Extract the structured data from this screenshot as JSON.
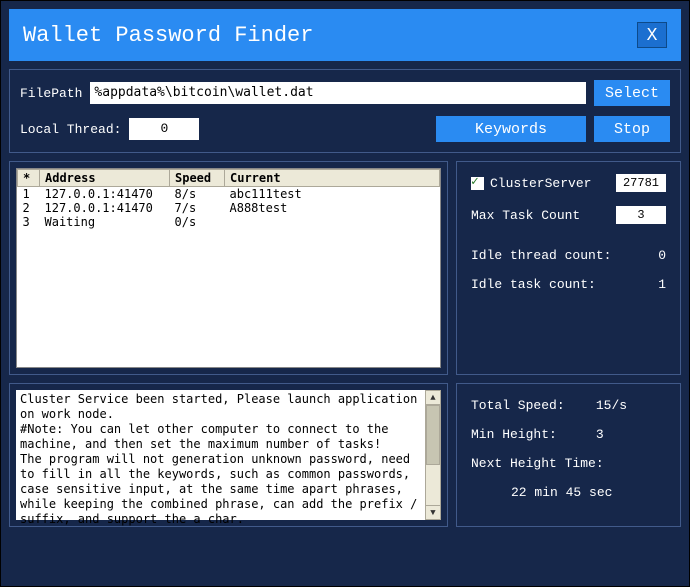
{
  "title": "Wallet Password Finder",
  "close_label": "X",
  "filepath_label": "FilePath",
  "filepath_value": "%appdata%\\bitcoin\\wallet.dat",
  "select_label": "Select",
  "localthread_label": "Local Thread:",
  "localthread_value": "0",
  "keywords_label": "Keywords",
  "stop_label": "Stop",
  "table": {
    "headers": [
      "*",
      "Address",
      "Speed",
      "Current"
    ],
    "rows": [
      [
        "1",
        "127.0.0.1:41470",
        "8/s",
        "abc111test"
      ],
      [
        "2",
        "127.0.0.1:41470",
        "7/s",
        "A888test"
      ],
      [
        "3",
        "Waiting",
        "0/s",
        ""
      ]
    ]
  },
  "cluster": {
    "clusterserver_label": "ClusterServer",
    "clusterserver_port": "27781",
    "maxtask_label": "Max Task Count",
    "maxtask_value": "3",
    "idlethread_label": "Idle thread count:",
    "idlethread_value": "0",
    "idletask_label": "Idle task count:",
    "idletask_value": "1"
  },
  "log_text": "Cluster Service been started, Please launch application on work node.\n#Note: You can let other computer to connect to the machine, and then set the maximum number of tasks!\nThe program will not generation unknown password, need to fill in all the keywords, such as common passwords, case sensitive input, at the same time apart phrases, while keeping the combined phrase, can add the prefix / suffix, and support the a char.",
  "stats": {
    "totalspeed_label": "Total Speed:",
    "totalspeed_value": "15/s",
    "minheight_label": "Min Height:",
    "minheight_value": "3",
    "nexttime_label": "Next Height Time:",
    "nexttime_value": "22 min 45 sec"
  }
}
